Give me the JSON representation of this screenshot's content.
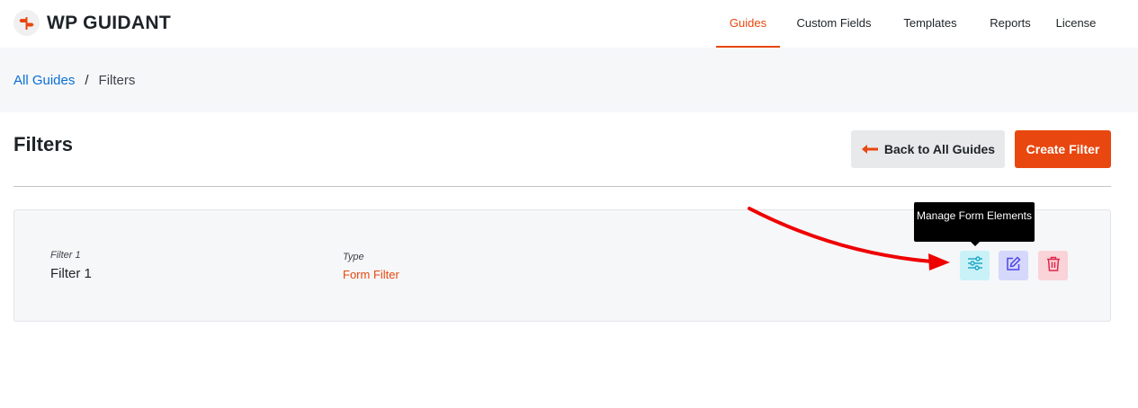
{
  "brand": {
    "name": "WP GUIDANT",
    "icon": "signpost-icon",
    "color": "#e8470f"
  },
  "nav": {
    "items": [
      {
        "label": "Guides",
        "active": true
      },
      {
        "label": "Custom Fields",
        "active": false
      },
      {
        "label": "Templates",
        "active": false
      },
      {
        "label": "Reports",
        "active": false
      },
      {
        "label": "License",
        "active": false
      }
    ]
  },
  "breadcrumb": {
    "parent": "All Guides",
    "separator": "/",
    "current": "Filters"
  },
  "page": {
    "title": "Filters",
    "back_label": "Back to All Guides",
    "create_label": "Create Filter"
  },
  "filters": [
    {
      "name_label": "Filter 1",
      "name": "Filter 1",
      "type_label": "Type",
      "type": "Form Filter",
      "actions": [
        {
          "name": "manage-form-elements",
          "icon": "sliders-icon",
          "tooltip": "Manage Form Elements"
        },
        {
          "name": "edit",
          "icon": "edit-icon"
        },
        {
          "name": "delete",
          "icon": "trash-icon"
        }
      ]
    }
  ],
  "colors": {
    "accent": "#e8470f",
    "link": "#0a6fd6",
    "annotation": "#ee0000"
  }
}
